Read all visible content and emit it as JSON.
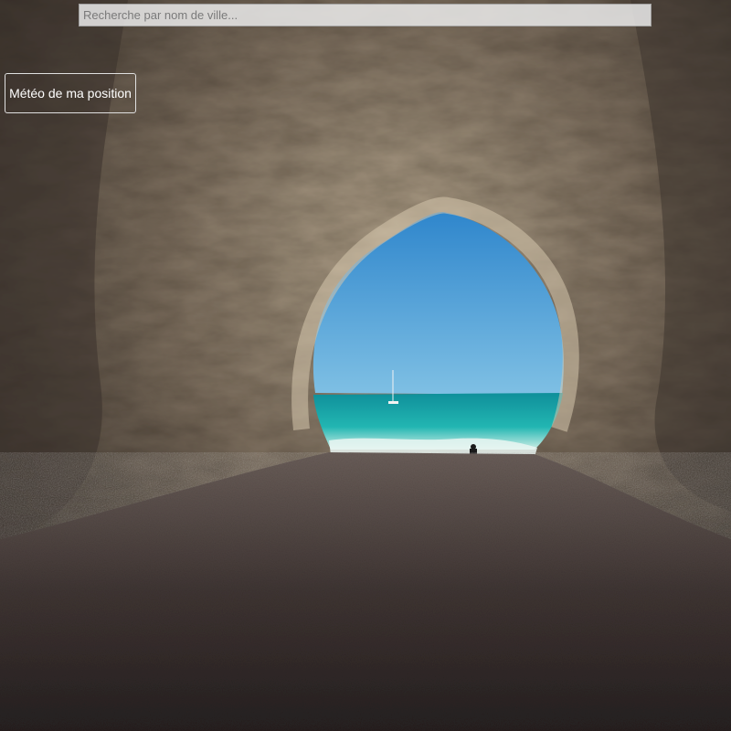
{
  "search": {
    "placeholder": "Recherche par nom de ville...",
    "value": ""
  },
  "geolocation_button": {
    "label": "Météo de ma position"
  },
  "background": {
    "icon": "cave-beach-photo",
    "colors": {
      "sky": "#3e95d0",
      "sea": "#1fb2b0",
      "rock": "#8a7b68",
      "sand": "#3b3230"
    }
  }
}
